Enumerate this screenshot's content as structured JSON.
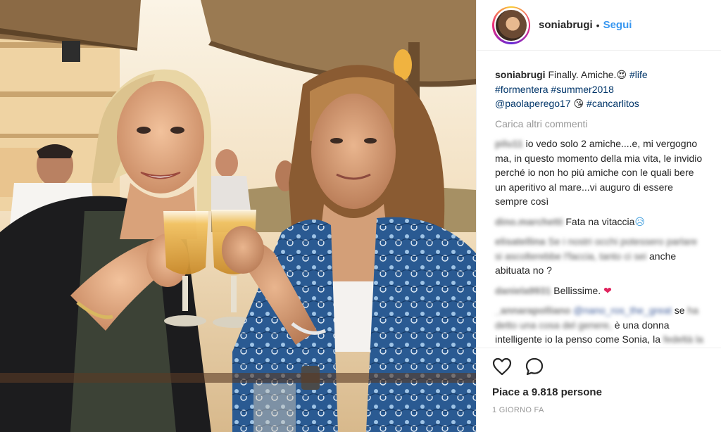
{
  "header": {
    "username": "soniabrugi",
    "separator": "•",
    "follow_label": "Segui"
  },
  "caption": {
    "username": "soniabrugi",
    "text": "Finally. Amiche.",
    "emoji": "😍",
    "hashtags": [
      "#life",
      "#formentera",
      "#summer2018"
    ],
    "mention": "@paolaperego17",
    "emoji2": "😘",
    "hashtag_last": "#cancarlitos"
  },
  "load_more_label": "Carica altri commenti",
  "comments": [
    {
      "user": "pilu11",
      "text": "io vedo solo 2 amiche....e, mi vergogno ma, in questo momento della mia vita, le invidio perché io non ho più amiche con le quali bere un aperitivo al mare...vi auguro di essere sempre così"
    },
    {
      "user": "dino.marchetti",
      "text": "Fata na vitaccia",
      "emoji": "😥"
    },
    {
      "user": "elisatellina",
      "blurred_text": "Se i nostri occhi potessero parlare si ascolterebbe l'faccia, tanto ci sei",
      "text": "anche abituata no ?"
    },
    {
      "user": "daniela9931",
      "text": "Bellissime.",
      "emoji": "❤"
    },
    {
      "user": "_annarapolliano",
      "mention": "@nano_ros_the_great",
      "text_tail": "se",
      "blurred_text": "ha detto una cosa del genere,",
      "text": "è una donna intelligente io la penso come Sonia, la",
      "clipped_text": "fedeltà la trovi nelle amiche..."
    }
  ],
  "actions": {
    "like_icon": "heart-outline-icon",
    "comment_icon": "speech-bubble-icon"
  },
  "likes_text": "Piace a 9.818 persone",
  "timestamp": "1 GIORNO FA"
}
